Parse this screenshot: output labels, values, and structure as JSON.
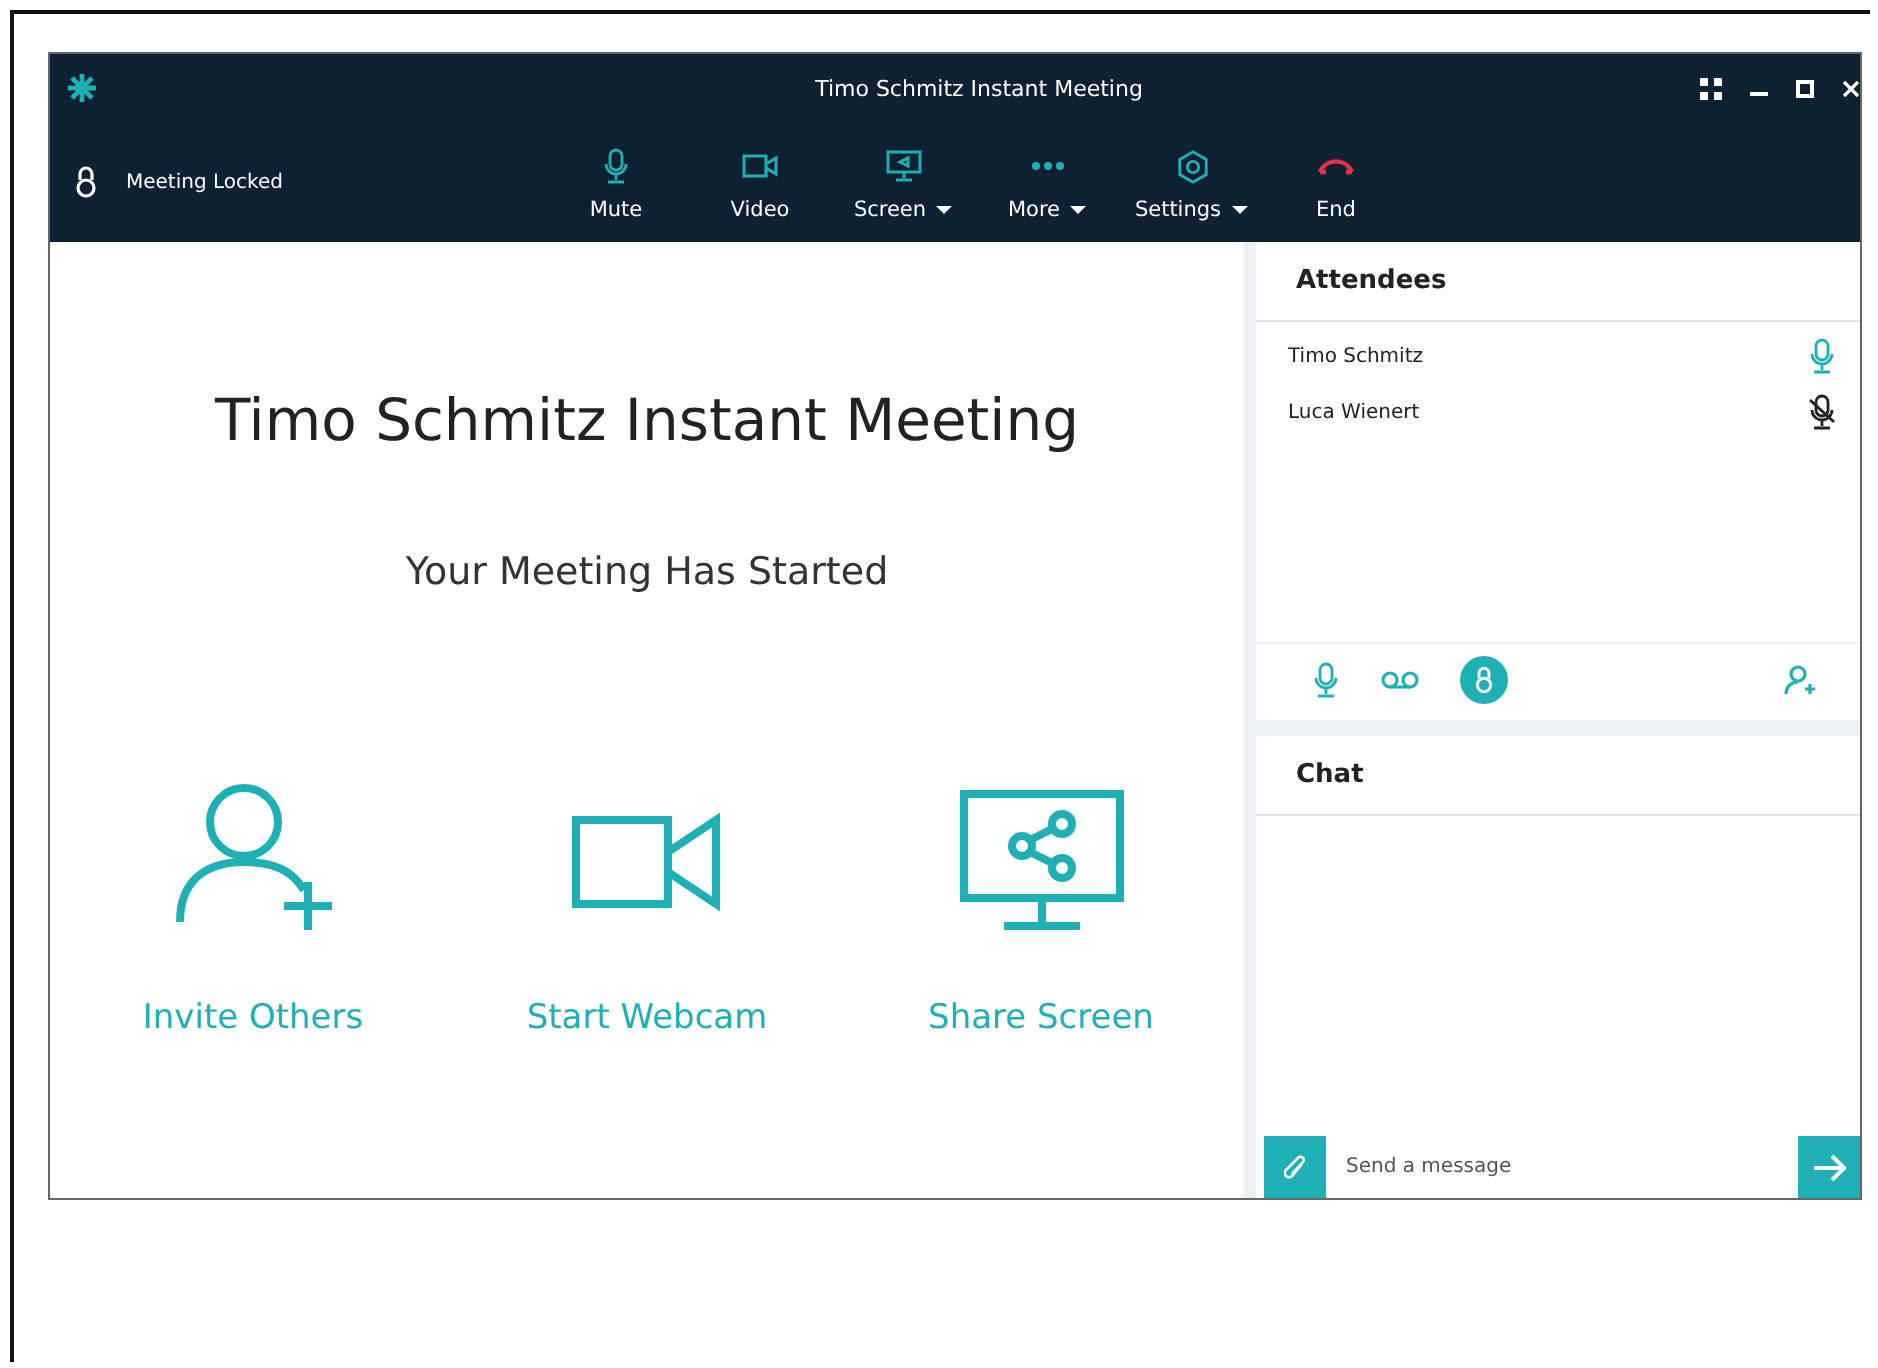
{
  "window": {
    "title": "Timo Schmitz Instant Meeting"
  },
  "toolbar": {
    "lock_status": "Meeting Locked",
    "buttons": [
      {
        "label": "Mute",
        "kind": "mic",
        "dropdown": false
      },
      {
        "label": "Video",
        "kind": "video",
        "dropdown": false
      },
      {
        "label": "Screen",
        "kind": "screen",
        "dropdown": true
      },
      {
        "label": "More",
        "kind": "more",
        "dropdown": true
      },
      {
        "label": "Settings",
        "kind": "settings",
        "dropdown": true
      },
      {
        "label": "End",
        "kind": "end",
        "dropdown": false
      }
    ]
  },
  "main": {
    "title": "Timo Schmitz Instant Meeting",
    "subtitle": "Your Meeting Has Started",
    "actions": [
      {
        "label": "Invite Others",
        "kind": "invite"
      },
      {
        "label": "Start Webcam",
        "kind": "webcam"
      },
      {
        "label": "Share Screen",
        "kind": "share"
      }
    ]
  },
  "attendees": {
    "title": "Attendees",
    "people": [
      {
        "name": "Timo Schmitz",
        "muted": false
      },
      {
        "name": "Luca Wienert",
        "muted": true
      }
    ]
  },
  "chat": {
    "title": "Chat",
    "placeholder": "Send a message"
  }
}
